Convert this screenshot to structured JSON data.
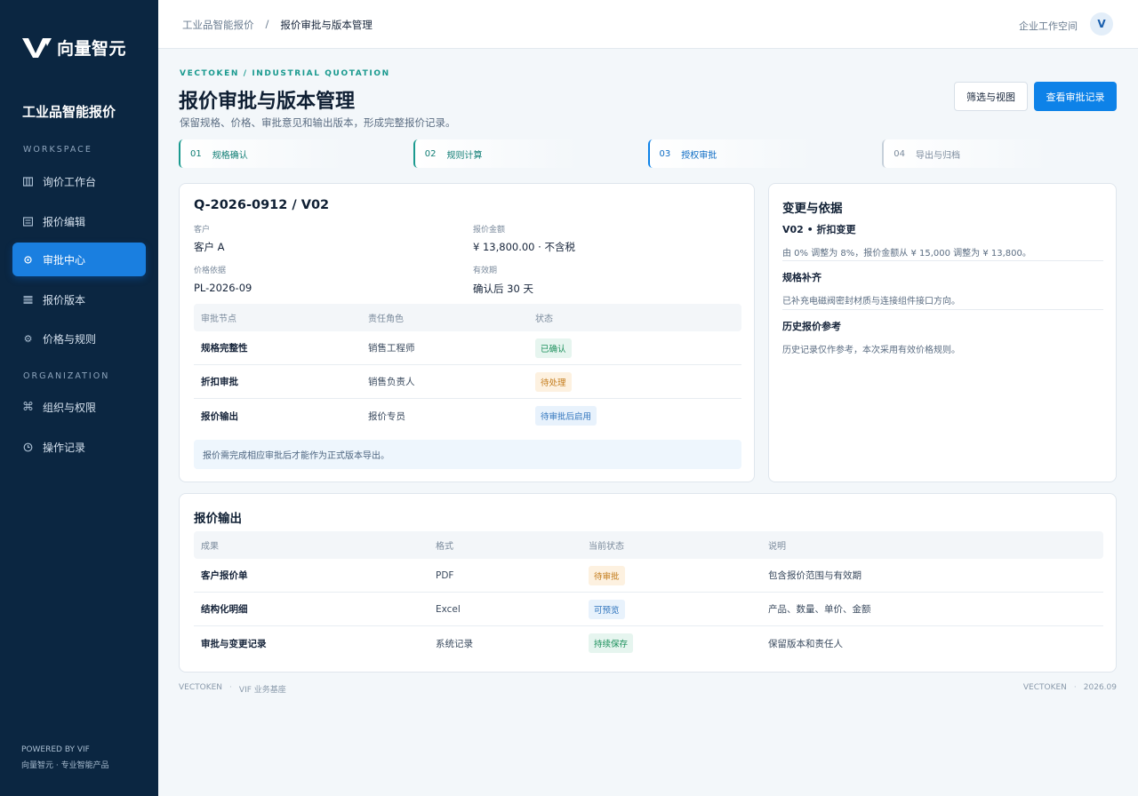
{
  "sidebar": {
    "brand": "向量智元",
    "product_title": "工业品智能报价",
    "section_workspace": "WORKSPACE",
    "section_org": "ORGANIZATION",
    "items": [
      {
        "label": "询价工作台",
        "icon": "columns-icon"
      },
      {
        "label": "报价编辑",
        "icon": "document-icon"
      },
      {
        "label": "审批中心",
        "icon": "approval-icon",
        "active": true
      },
      {
        "label": "报价版本",
        "icon": "versions-icon"
      },
      {
        "label": "价格与规则",
        "icon": "gear-icon"
      },
      {
        "label": "组织与权限",
        "icon": "command-icon"
      },
      {
        "label": "操作记录",
        "icon": "clock-icon"
      }
    ],
    "footer_line1": "POWERED BY VIF",
    "footer_line2": "向量智元 · 专业智能产品"
  },
  "topbar": {
    "breadcrumb_root": "工业品智能报价",
    "breadcrumb_sep": "/",
    "breadcrumb_current": "报价审批与版本管理",
    "workspace": "企业工作空间",
    "avatar": "V"
  },
  "header": {
    "eyebrow": "VECTOKEN / INDUSTRIAL QUOTATION",
    "title": "报价审批与版本管理",
    "subtitle": "保留规格、价格、审批意见和输出版本，形成完整报价记录。",
    "btn_filter": "筛选与视图",
    "btn_records": "查看审批记录"
  },
  "steps": [
    {
      "num": "01",
      "label": "规格确认"
    },
    {
      "num": "02",
      "label": "规则计算"
    },
    {
      "num": "03",
      "label": "授权审批"
    },
    {
      "num": "04",
      "label": "导出与归档"
    }
  ],
  "quote": {
    "id": "Q-2026-0912 / V02",
    "customer_label": "客户",
    "customer_value": "客户 A",
    "amount_label": "报价金额",
    "amount_value": "¥ 13,800.00 · 不含税",
    "basis_label": "价格依据",
    "basis_value": "PL-2026-09",
    "validity_label": "有效期",
    "validity_value": "确认后 30 天",
    "table": {
      "headers": [
        "审批节点",
        "责任角色",
        "状态"
      ],
      "rows": [
        {
          "node": "规格完整性",
          "role": "销售工程师",
          "status": "已确认",
          "tone": "green"
        },
        {
          "node": "折扣审批",
          "role": "销售负责人",
          "status": "待处理",
          "tone": "orange"
        },
        {
          "node": "报价输出",
          "role": "报价专员",
          "status": "待审批后启用",
          "tone": "blue"
        }
      ]
    },
    "notice": "报价需完成相应审批后才能作为正式版本导出。"
  },
  "evidence": {
    "title": "变更与依据",
    "items": [
      {
        "title": "V02 • 折扣变更",
        "desc": "由 0% 调整为 8%，报价金额从 ¥ 15,000 调整为 ¥ 13,800。"
      },
      {
        "title": "规格补齐",
        "desc": "已补充电磁阀密封材质与连接组件接口方向。"
      },
      {
        "title": "历史报价参考",
        "desc": "历史记录仅作参考，本次采用有效价格规则。"
      }
    ]
  },
  "output": {
    "title": "报价输出",
    "headers": [
      "成果",
      "格式",
      "当前状态",
      "说明"
    ],
    "rows": [
      {
        "name": "客户报价单",
        "format": "PDF",
        "status": "待审批",
        "tone": "orange",
        "desc": "包含报价范围与有效期"
      },
      {
        "name": "结构化明细",
        "format": "Excel",
        "status": "可预览",
        "tone": "blue",
        "desc": "产品、数量、单价、金额"
      },
      {
        "name": "审批与变更记录",
        "format": "系统记录",
        "status": "持续保存",
        "tone": "green",
        "desc": "保留版本和责任人"
      }
    ]
  },
  "footer": {
    "left_brand": "VECTOKEN",
    "left_sep": "·",
    "left_text": "VIF 业务基座",
    "right_brand": "VECTOKEN",
    "right_sep": "·",
    "right_text": "2026.09"
  },
  "colors": {
    "sidebar_bg": "#0b2641",
    "accent_blue": "#0d82e8",
    "accent_teal": "#1a9a8f",
    "page_bg": "#f3f7fa"
  }
}
